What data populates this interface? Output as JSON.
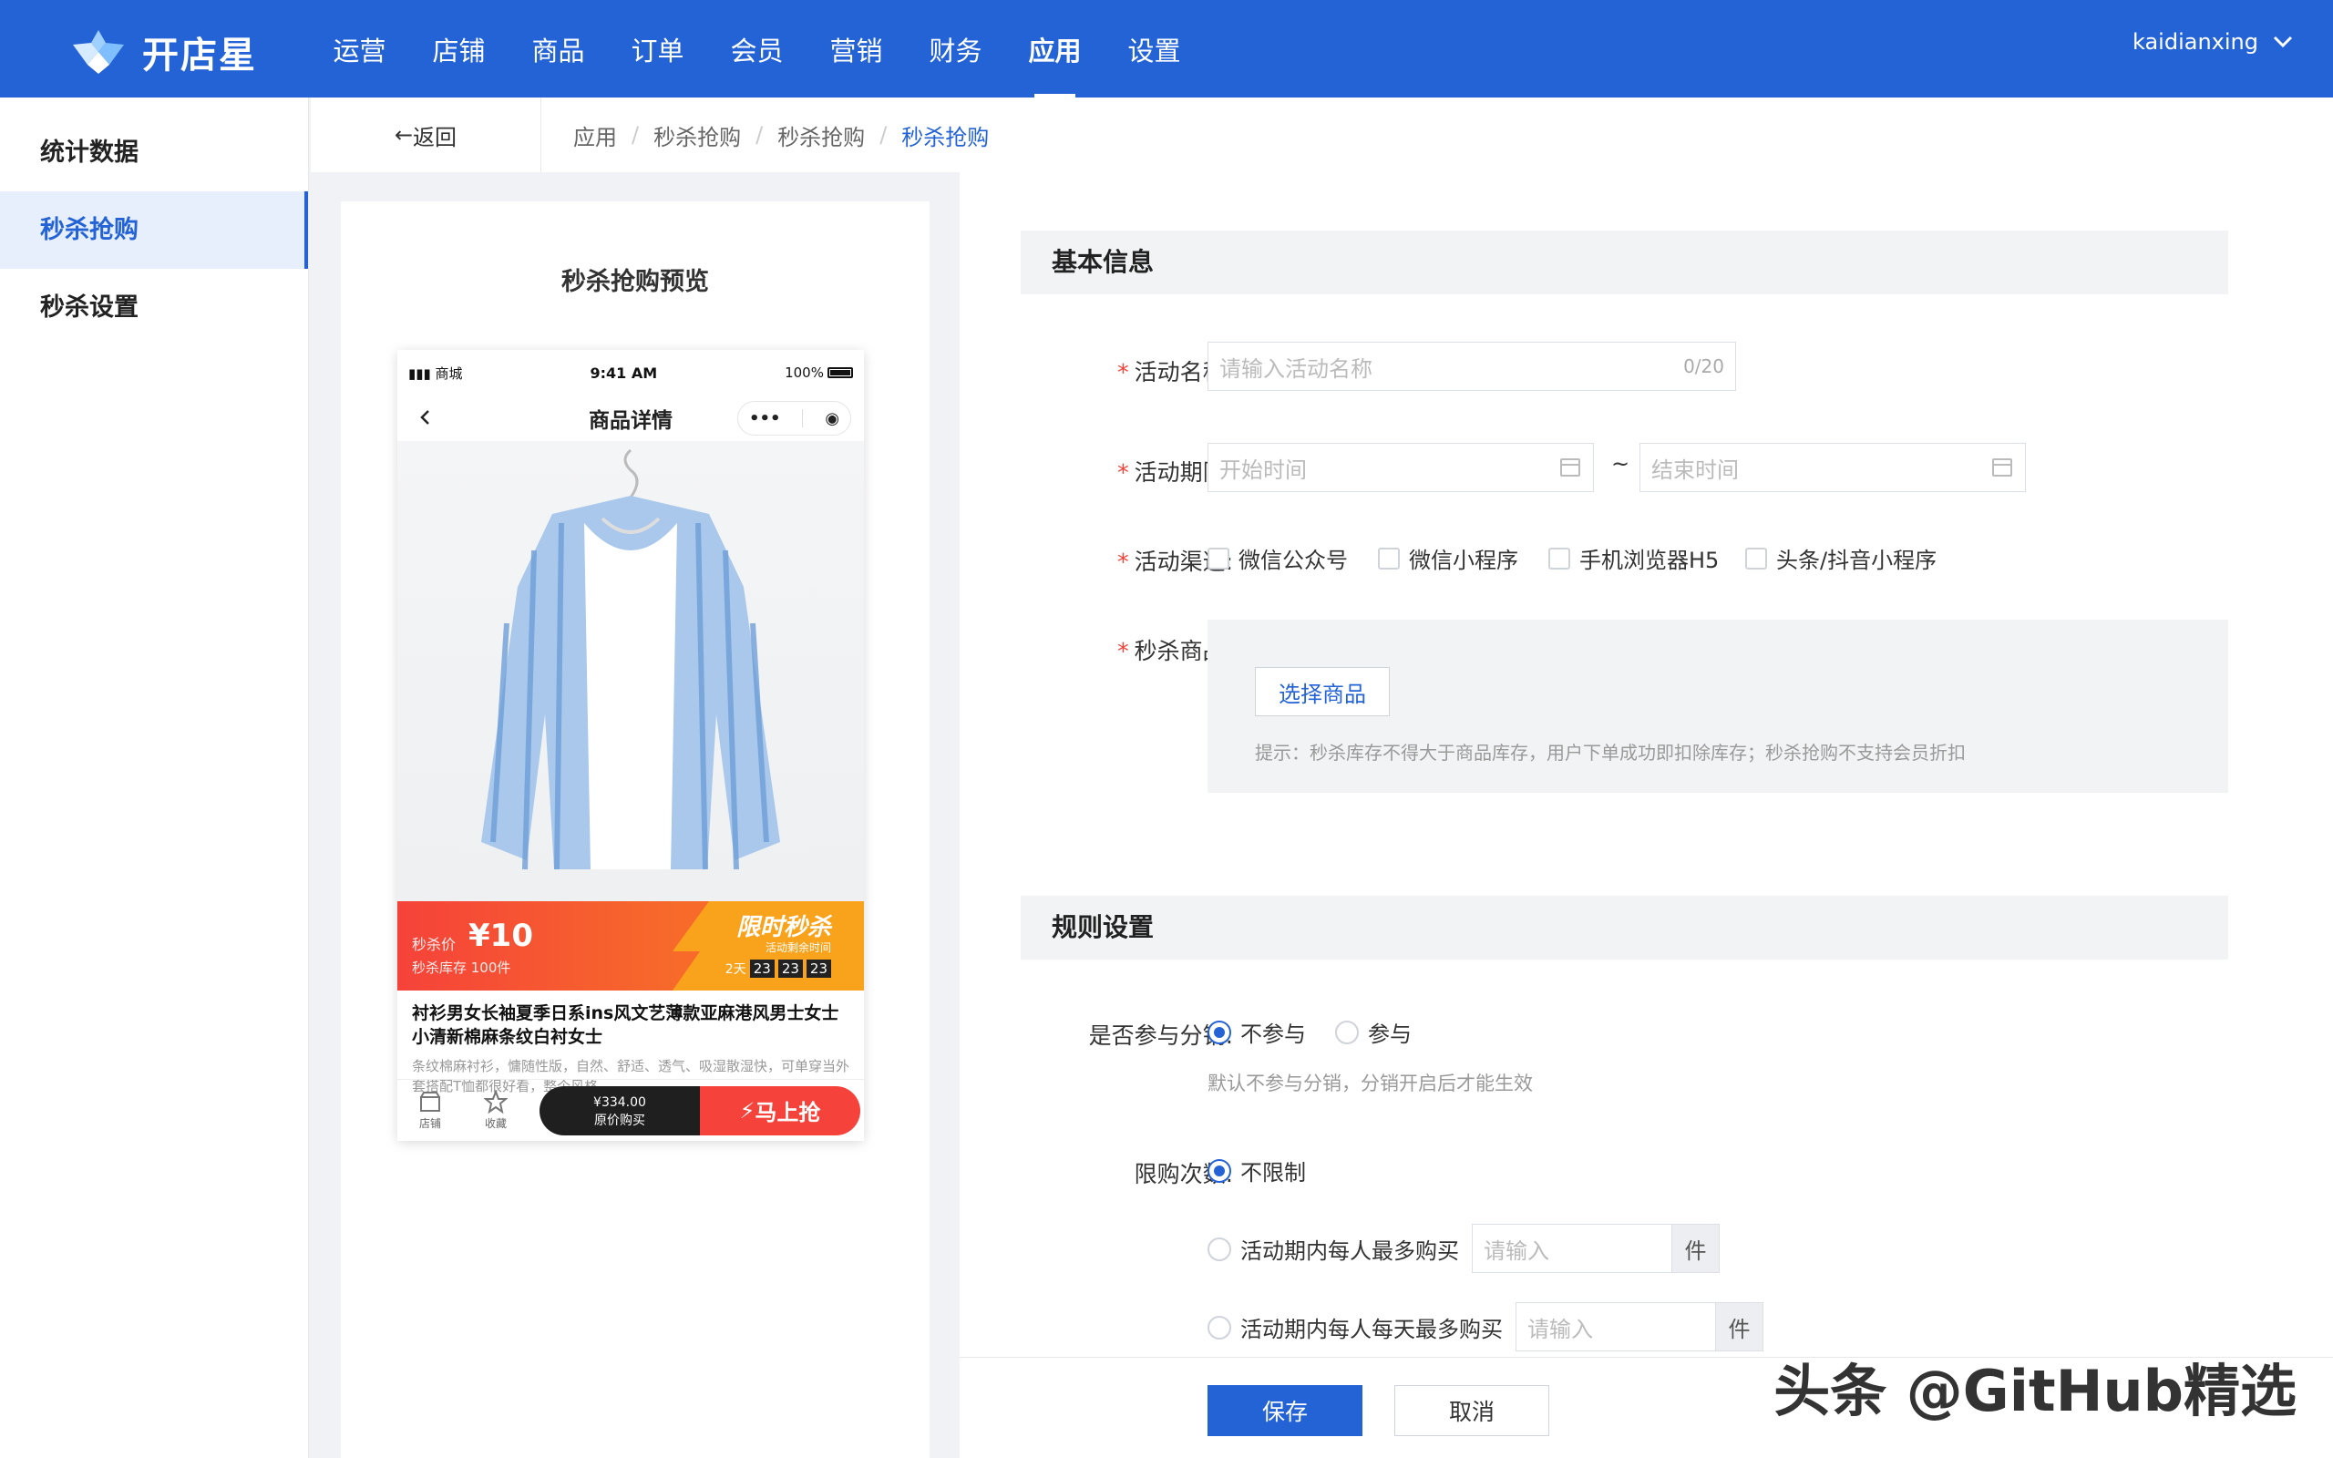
{
  "app": {
    "logo_text": "开店星",
    "user": "kaidianxing"
  },
  "nav": [
    {
      "label": "运营"
    },
    {
      "label": "店铺"
    },
    {
      "label": "商品"
    },
    {
      "label": "订单"
    },
    {
      "label": "会员"
    },
    {
      "label": "营销"
    },
    {
      "label": "财务"
    },
    {
      "label": "应用",
      "active": true
    },
    {
      "label": "设置"
    }
  ],
  "sidebar": {
    "items": [
      {
        "label": "统计数据"
      },
      {
        "label": "秒杀抢购",
        "active": true
      },
      {
        "label": "秒杀设置"
      }
    ]
  },
  "breadcrumb": {
    "back": "返回",
    "items": [
      "应用",
      "秒杀抢购",
      "秒杀抢购",
      "秒杀抢购"
    ]
  },
  "preview": {
    "title": "秒杀抢购预览",
    "status_left": "商城",
    "status_time": "9:41 AM",
    "status_battery": "100%",
    "page_title": "商品详情",
    "price_label": "秒杀价",
    "price": "¥10",
    "stock": "秒杀库存  100件",
    "promo_title": "限时秒杀",
    "promo_sub": "活动剩余时间",
    "countdown_days": "2天",
    "countdown": [
      "23",
      "23",
      "23"
    ],
    "product_title": "衬衫男女长袖夏季日系ins风文艺薄款亚麻港风男士女士小清新棉麻条纹白衬女士",
    "product_desc": "条纹棉麻衬衫，慵随性版，自然、舒适、透气、吸湿散湿快，可单穿当外套搭配T恤都很好看，整个风格",
    "foot_shop": "店铺",
    "foot_fav": "收藏",
    "orig_price": "¥334.00",
    "orig_label": "原价购买",
    "buy_now": "马上抢"
  },
  "form": {
    "basic_title": "基本信息",
    "name_label": "活动名称:",
    "name_placeholder": "请输入活动名称",
    "name_count": "0/20",
    "period_label": "活动期限:",
    "start_placeholder": "开始时间",
    "tilde": "~",
    "end_placeholder": "结束时间",
    "channel_label": "活动渠道:",
    "channels": [
      "微信公众号",
      "微信小程序",
      "手机浏览器H5",
      "头条/抖音小程序"
    ],
    "goods_label": "秒杀商品:",
    "select_goods": "选择商品",
    "goods_hint": "提示：秒杀库存不得大于商品库存，用户下单成功即扣除库存；秒杀抢购不支持会员折扣",
    "rules_title": "规则设置",
    "dist_label": "是否参与分销:",
    "dist_no": "不参与",
    "dist_yes": "参与",
    "dist_note": "默认不参与分销，分销开启后才能生效",
    "limit_label": "限购次数:",
    "limit_none": "不限制",
    "limit_per_person": "活动期内每人最多购买",
    "limit_per_day": "活动期内每人每天最多购买",
    "qty_placeholder": "请输入",
    "unit": "件"
  },
  "actions": {
    "save": "保存",
    "cancel": "取消"
  },
  "watermark": "头条 @GitHub精选",
  "colors": {
    "primary": "#2363d6",
    "danger": "#f5423a"
  }
}
